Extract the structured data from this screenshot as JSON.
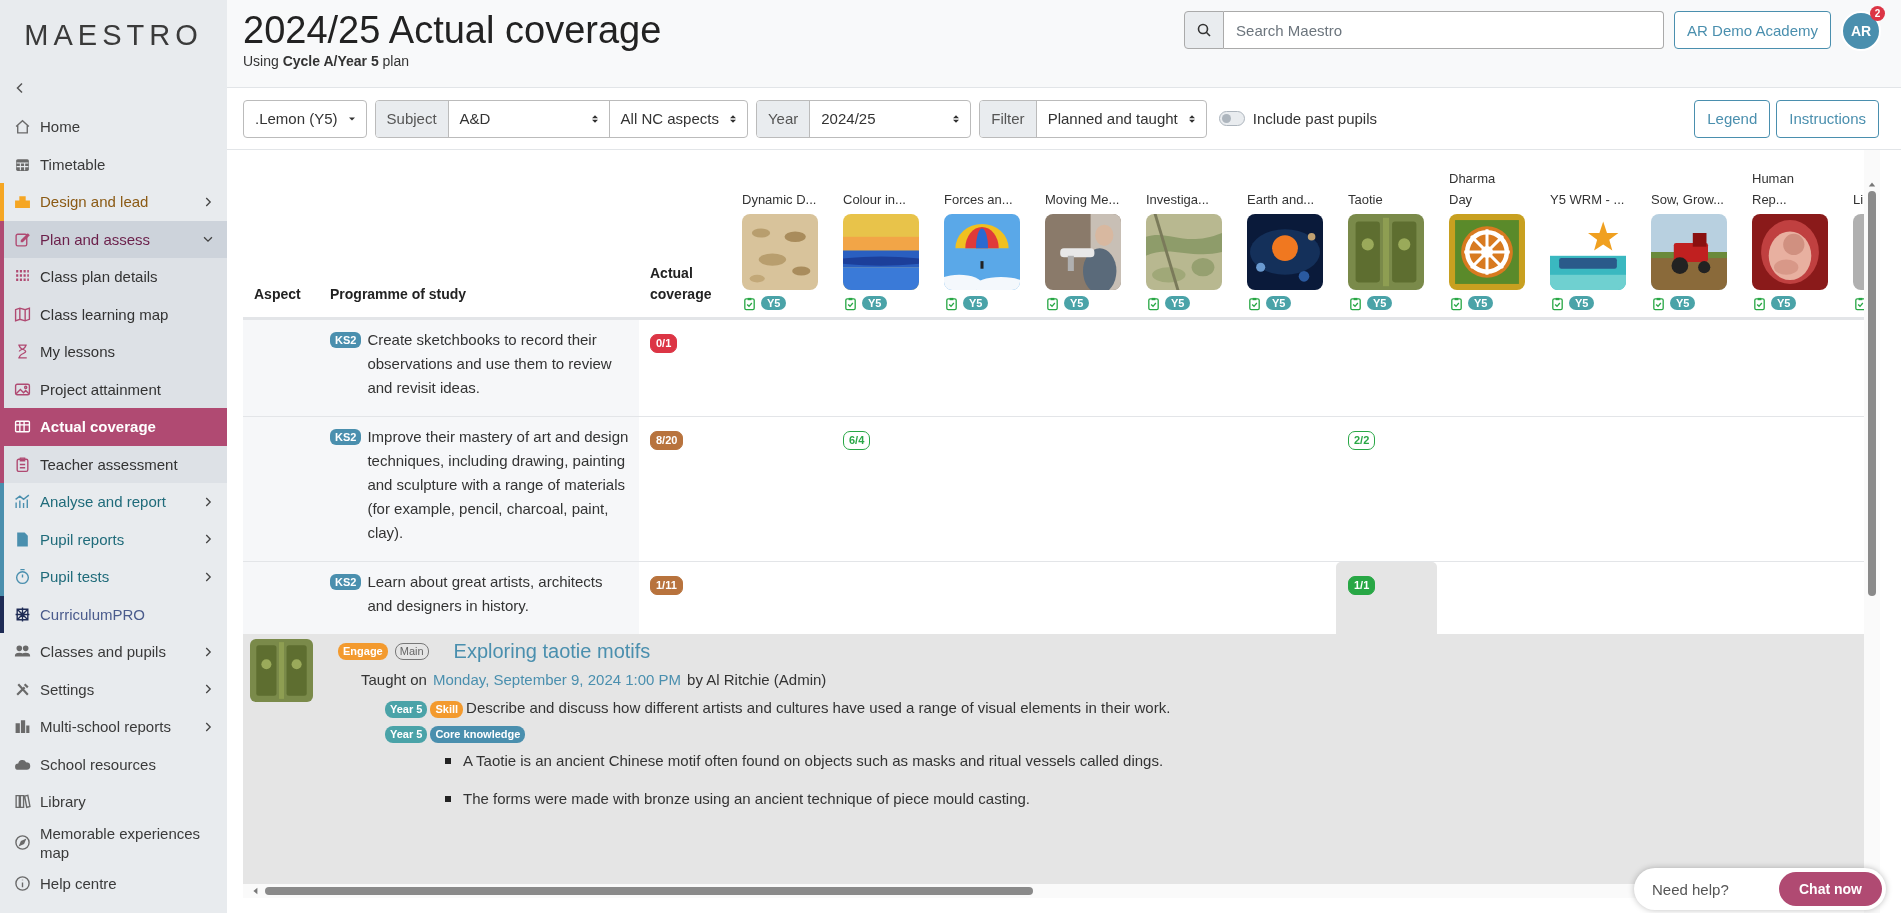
{
  "sidebar": {
    "logo": "MAESTRO",
    "items": [
      {
        "label": "Home",
        "selected": false
      },
      {
        "label": "Timetable",
        "selected": false
      },
      {
        "label": "Design and lead",
        "kind": "design",
        "selected": false,
        "expandable": true,
        "expanded": false
      },
      {
        "label": "Plan and assess",
        "kind": "plan",
        "selected": false,
        "expandable": true,
        "expanded": true,
        "children": [
          {
            "label": "Class plan details",
            "selected": false
          },
          {
            "label": "Class learning map",
            "selected": false
          },
          {
            "label": "My lessons",
            "selected": false
          },
          {
            "label": "Project attainment",
            "selected": false
          },
          {
            "label": "Actual coverage",
            "selected": true
          },
          {
            "label": "Teacher assessment",
            "selected": false
          }
        ]
      },
      {
        "label": "Analyse and report",
        "kind": "report",
        "selected": false,
        "expandable": true,
        "expanded": false
      },
      {
        "label": "Pupil reports",
        "kind": "report",
        "selected": false,
        "expandable": true,
        "expanded": false
      },
      {
        "label": "Pupil tests",
        "kind": "report",
        "selected": false,
        "expandable": true,
        "expanded": false
      },
      {
        "label": "CurriculumPRO",
        "kind": "curriculum",
        "selected": false
      },
      {
        "label": "Classes and pupils",
        "selected": false,
        "expandable": true,
        "expanded": false
      },
      {
        "label": "Settings",
        "selected": false,
        "expandable": true,
        "expanded": false
      },
      {
        "label": "Multi-school reports",
        "selected": false,
        "expandable": true,
        "expanded": false
      },
      {
        "label": "School resources",
        "selected": false
      },
      {
        "label": "Library",
        "selected": false
      },
      {
        "label": "Memorable experiences map",
        "selected": false
      },
      {
        "label": "Help centre",
        "selected": false
      }
    ]
  },
  "header": {
    "title": "2024/25 Actual coverage",
    "subtitle": "Using **Cycle A/Year 5** plan",
    "search": {
      "placeholder": "Search Maestro"
    },
    "school": "AR Demo Academy",
    "avatar": "AR",
    "notifications": "2"
  },
  "filters": {
    "groups": [
      {
        "selects": [
          {
            "value": ".Lemon (Y5)",
            "kind": "caret"
          }
        ]
      },
      {
        "label": "Subject",
        "selects": [
          {
            "value": "A&D",
            "kind": "updown"
          },
          {
            "value": "All NC aspects",
            "kind": "updown"
          }
        ]
      },
      {
        "label": "Year",
        "selects": [
          {
            "value": "2024/25",
            "kind": "updown"
          }
        ]
      },
      {
        "label": "Filter",
        "selects": [
          {
            "value": "Planned and taught",
            "kind": "updown"
          }
        ]
      }
    ],
    "toggle": {
      "label": "Include past pupils",
      "on": false
    },
    "buttons": [
      "Legend",
      "Instructions"
    ]
  },
  "table": {
    "columns": [
      "Aspect",
      "Programme of study",
      "Actual coverage"
    ],
    "lessons": [
      {
        "title": "Dynamic D...",
        "planned": true,
        "year": "Y5"
      },
      {
        "title": "Colour in...",
        "planned": true,
        "year": "Y5"
      },
      {
        "title": "Forces an...",
        "planned": true,
        "year": "Y5"
      },
      {
        "title": "Moving Me...",
        "planned": true,
        "year": "Y5"
      },
      {
        "title": "Investiga...",
        "planned": true,
        "year": "Y5"
      },
      {
        "title": "Earth and...",
        "planned": true,
        "year": "Y5"
      },
      {
        "title": "Taotie",
        "planned": true,
        "year": "Y5"
      },
      {
        "title": "Dharma\nDay",
        "planned": true,
        "year": "Y5"
      },
      {
        "title": "Y5 WRM - ...",
        "planned": true,
        "year": "Y5"
      },
      {
        "title": "Sow, Grow...",
        "planned": true,
        "year": "Y5"
      },
      {
        "title": "Human\nRep...",
        "planned": true,
        "year": "Y5"
      },
      {
        "title": "Li",
        "planned": true
      }
    ],
    "rows": [
      {
        "stage": "KS2",
        "text": "Create sketchbooks to record their observations and use them to review and revisit ideas.",
        "coverage": {
          "text": "0/1",
          "color": "#dc3545"
        },
        "cells": [
          null,
          null,
          null,
          null,
          null,
          null,
          null,
          null,
          null,
          null,
          null,
          null
        ]
      },
      {
        "stage": "KS2",
        "text": "Improve their mastery of art and design techniques, including drawing, painting and sculpture with a range of materials (for example, pencil, charcoal, paint, clay).",
        "coverage": {
          "text": "8/20",
          "color": "#b8733d"
        },
        "cells": [
          null,
          {
            "text": "6/4",
            "color": "#28a745",
            "outline": true,
            "selected": false
          },
          null,
          null,
          null,
          null,
          {
            "text": "2/2",
            "color": "#28a745",
            "outline": true,
            "selected": false
          },
          null,
          null,
          null,
          null,
          null
        ]
      },
      {
        "stage": "KS2",
        "text": "Learn about great artists, architects and designers in history.",
        "coverage": {
          "text": "1/11",
          "color": "#b8733d"
        },
        "cells": [
          null,
          null,
          null,
          null,
          null,
          null,
          {
            "text": "1/1",
            "color": "#28a745",
            "outline": false,
            "selected": true
          },
          null,
          null,
          null,
          null,
          null
        ]
      }
    ],
    "detail": {
      "tags": [
        {
          "text": "Engage",
          "kind": "phase"
        },
        {
          "text": "Main",
          "kind": "outline"
        }
      ],
      "title": "Exploring taotie motifs",
      "taught_label": "Taught on",
      "date": "Monday, September 9, 2024 1:00 PM",
      "taught_by": "by Al Ritchie (Admin)",
      "objectives": [
        {
          "tags": [
            {
              "text": "Year 5",
              "kind": "year"
            },
            {
              "text": "Skill",
              "kind": "phase"
            }
          ],
          "text": "Describe and discuss how different artists and cultures have used a range of visual elements in their work."
        },
        {
          "tags": [
            {
              "text": "Year 5",
              "kind": "year"
            },
            {
              "text": "Core knowledge",
              "kind": "knowledge"
            }
          ],
          "bullets": [
            "A Taotie is an ancient Chinese motif often found on objects such as masks and ritual vessels called dings.",
            "The forms were made with bronze using an ancient technique of piece mould casting."
          ]
        }
      ]
    }
  },
  "help": {
    "prompt": "Need help?",
    "button": "Chat now"
  }
}
